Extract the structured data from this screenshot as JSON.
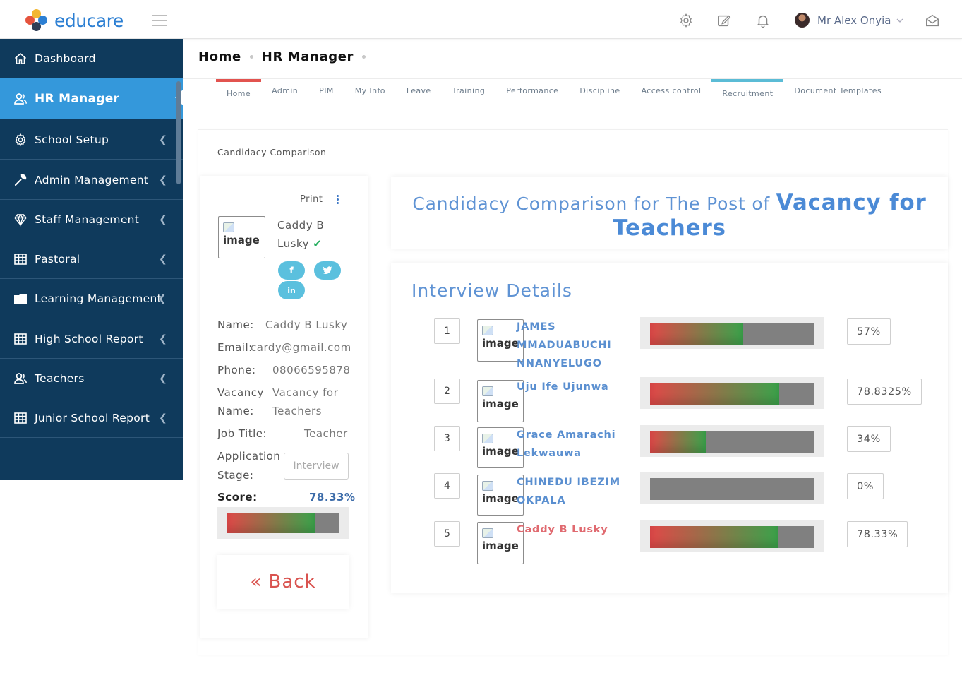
{
  "brand": {
    "name": "educare"
  },
  "topbar": {
    "user_name": "Mr Alex Onyia"
  },
  "sidebar": {
    "items": [
      {
        "label": "Dashboard",
        "icon": "home-icon"
      },
      {
        "label": "HR Manager",
        "icon": "users-icon",
        "active": true
      },
      {
        "label": "School Setup",
        "icon": "gear-icon"
      },
      {
        "label": "Admin Management",
        "icon": "wrench-icon"
      },
      {
        "label": "Staff Management",
        "icon": "diamond-icon"
      },
      {
        "label": "Pastoral",
        "icon": "grid-icon"
      },
      {
        "label": "Learning Management",
        "icon": "folder-icon"
      },
      {
        "label": "High School Report",
        "icon": "grid-icon"
      },
      {
        "label": "Teachers",
        "icon": "users-icon"
      },
      {
        "label": "Junior School Report",
        "icon": "grid-icon"
      }
    ]
  },
  "breadcrumb": {
    "home": "Home",
    "current": "HR Manager"
  },
  "tabs": [
    "Home",
    "Admin",
    "PIM",
    "My Info",
    "Leave",
    "Training",
    "Performance",
    "Discipline",
    "Access control",
    "Recruitment",
    "Document Templates"
  ],
  "panel": {
    "title": "Candidacy Comparison"
  },
  "profile": {
    "print_label": "Print",
    "image_alt": "image",
    "name_line1": "Caddy B",
    "name_line2": "Lusky",
    "check": "✔",
    "fields": {
      "name_label": "Name:",
      "name_value": "Caddy B Lusky",
      "email_label": "Email:",
      "email_value": "cardy@gmail.com",
      "phone_label": "Phone:",
      "phone_value": "08066595878",
      "vacancy_label_1": "Vacancy",
      "vacancy_label_2": "Name:",
      "vacancy_value_1": "Vacancy for",
      "vacancy_value_2": "Teachers",
      "job_label": "Job Title:",
      "job_value": "Teacher",
      "stage_label_1": "Application",
      "stage_label_2": "Stage:",
      "stage_value": "Interview"
    },
    "score_label": "Score:",
    "score_value": "78.33%",
    "score_fraction": 0.7833,
    "back_label": "« Back"
  },
  "heading": {
    "prefix": "Candidacy Comparison for The Post of ",
    "vacancy_line1": "Vacancy for",
    "vacancy_line2": "Teachers"
  },
  "interview": {
    "title": "Interview Details",
    "image_alt": "image",
    "rows": [
      {
        "rank": "1",
        "name_lines": [
          "JAMES",
          "MMADUABUCHI",
          "NNANYELUGO"
        ],
        "percent_label": "57%",
        "fraction": 0.57,
        "highlight": false
      },
      {
        "rank": "2",
        "name_lines": [
          "Uju Ife Ujunwa"
        ],
        "percent_label": "78.8325%",
        "fraction": 0.788325,
        "highlight": false
      },
      {
        "rank": "3",
        "name_lines": [
          "Grace Amarachi",
          "Lekwauwa"
        ],
        "percent_label": "34%",
        "fraction": 0.34,
        "highlight": false
      },
      {
        "rank": "4",
        "name_lines": [
          "CHINEDU IBEZIM",
          "OKPALA"
        ],
        "percent_label": "0%",
        "fraction": 0.0,
        "highlight": false
      },
      {
        "rank": "5",
        "name_lines": [
          "Caddy B Lusky"
        ],
        "percent_label": "78.33%",
        "fraction": 0.7833,
        "highlight": true
      }
    ]
  },
  "colors": {
    "sidebar_bg": "#0f3a5c",
    "active": "#3498db",
    "accent_blue": "#5f93d4",
    "back_red": "#d9534f"
  }
}
